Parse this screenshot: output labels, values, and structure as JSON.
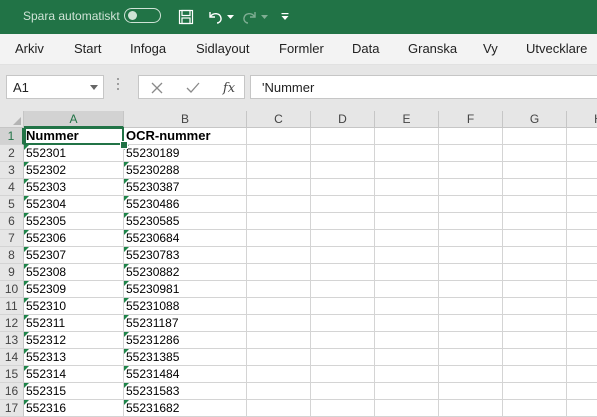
{
  "titlebar": {
    "autosave_label": "Spara automatiskt",
    "autosave_on": false,
    "icons": [
      "save-icon",
      "undo-icon",
      "redo-icon",
      "customize-toolbar-icon"
    ]
  },
  "ribbon": {
    "tabs": [
      "Arkiv",
      "Start",
      "Infoga",
      "Sidlayout",
      "Formler",
      "Data",
      "Granska",
      "Vy",
      "Utvecklare"
    ]
  },
  "formula_bar": {
    "name_box": "A1",
    "fx_label": "fx",
    "content": "'Nummer"
  },
  "grid": {
    "columns": [
      "A",
      "B",
      "C",
      "D",
      "E",
      "F",
      "G",
      "H"
    ],
    "selected_cell": "A1",
    "rows": [
      {
        "n": "1",
        "a": "Nummer",
        "b": "OCR-nummer"
      },
      {
        "n": "2",
        "a": "552301",
        "b": "55230189"
      },
      {
        "n": "3",
        "a": "552302",
        "b": "55230288"
      },
      {
        "n": "4",
        "a": "552303",
        "b": "55230387"
      },
      {
        "n": "5",
        "a": "552304",
        "b": "55230486"
      },
      {
        "n": "6",
        "a": "552305",
        "b": "55230585"
      },
      {
        "n": "7",
        "a": "552306",
        "b": "55230684"
      },
      {
        "n": "8",
        "a": "552307",
        "b": "55230783"
      },
      {
        "n": "9",
        "a": "552308",
        "b": "55230882"
      },
      {
        "n": "10",
        "a": "552309",
        "b": "55230981"
      },
      {
        "n": "11",
        "a": "552310",
        "b": "55231088"
      },
      {
        "n": "12",
        "a": "552311",
        "b": "55231187"
      },
      {
        "n": "13",
        "a": "552312",
        "b": "55231286"
      },
      {
        "n": "14",
        "a": "552313",
        "b": "55231385"
      },
      {
        "n": "15",
        "a": "552314",
        "b": "55231484"
      },
      {
        "n": "16",
        "a": "552315",
        "b": "55231583"
      },
      {
        "n": "17",
        "a": "552316",
        "b": "55231682"
      }
    ]
  },
  "colors": {
    "accent": "#217346",
    "error_indicator": "#1e8449"
  }
}
